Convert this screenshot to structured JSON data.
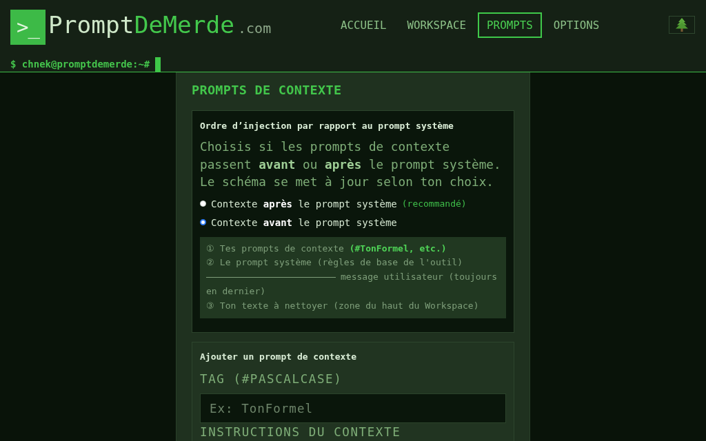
{
  "header": {
    "logo": {
      "symbol": ">_",
      "name_start": "Prompt",
      "name_end": "DeMerde",
      "suffix": ".com"
    },
    "nav": [
      {
        "label": "ACCUEIL",
        "selected": false
      },
      {
        "label": "WORKSPACE",
        "selected": false
      },
      {
        "label": "PROMPTS",
        "selected": true
      },
      {
        "label": "OPTIONS",
        "selected": false
      }
    ],
    "prompt_line": "$ chnek@promptdemerde:~#"
  },
  "panel": {
    "title": "PROMPTS DE CONTEXTE",
    "injection_order": {
      "heading": "Ordre d’injection par rapport au prompt système",
      "description": "Choisis si les prompts de contexte passent **avant** ou **après** le prompt système. Le schéma se met à jour selon ton choix.",
      "options": [
        {
          "label": "Contexte **après** le prompt système",
          "note": "(recommandé)",
          "selected": false
        },
        {
          "label": "Contexte **avant** le prompt système",
          "selected": true
        }
      ],
      "schema": [
        {
          "kind": "step",
          "text": "① Tes prompts de contexte **(#TonFormel, etc.)**"
        },
        {
          "kind": "step",
          "text": "② Le prompt système (règles de base de l'outil)"
        },
        {
          "kind": "separator",
          "text": "message utilisateur (toujours en dernier)"
        },
        {
          "kind": "step",
          "text": "③ Ton texte à nettoyer (zone du haut du Workspace)"
        }
      ]
    },
    "add_prompt": {
      "heading": "Ajouter un prompt de contexte",
      "tag_label": "TAG (#PASCALCASE)",
      "tag_placeholder": "Ex: TonFormel",
      "instructions_label": "INSTRUCTIONS DU CONTEXTE"
    }
  }
}
